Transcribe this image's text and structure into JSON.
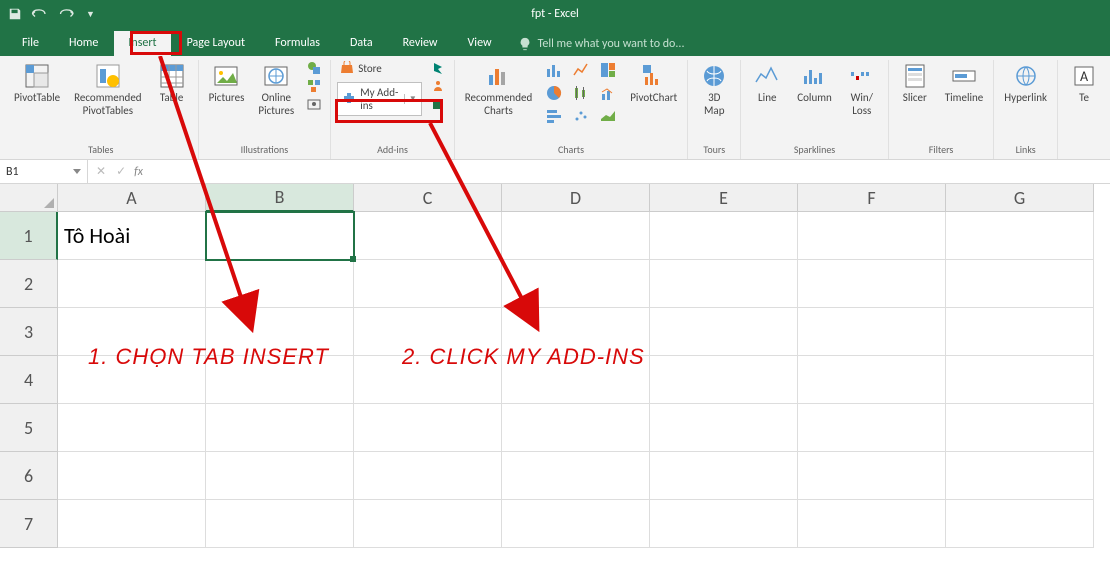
{
  "app": {
    "title": "fpt - Excel"
  },
  "tabs": {
    "file": "File",
    "home": "Home",
    "insert": "Insert",
    "pagelayout": "Page Layout",
    "formulas": "Formulas",
    "data": "Data",
    "review": "Review",
    "view": "View",
    "tellme": "Tell me what you want to do..."
  },
  "ribbon": {
    "tables": {
      "label": "Tables",
      "pivot": "PivotTable",
      "rec": "Recommended\nPivotTables",
      "table": "Table"
    },
    "illus": {
      "label": "Illustrations",
      "pictures": "Pictures",
      "online": "Online\nPictures"
    },
    "addins": {
      "label": "Add-ins",
      "store": "Store",
      "my": "My Add-ins"
    },
    "charts": {
      "label": "Charts",
      "rec": "Recommended\nCharts",
      "pivot": "PivotChart"
    },
    "tours": {
      "label": "Tours",
      "map": "3D\nMap"
    },
    "spark": {
      "label": "Sparklines",
      "line": "Line",
      "col": "Column",
      "wl": "Win/\nLoss"
    },
    "filters": {
      "label": "Filters",
      "slicer": "Slicer",
      "tl": "Timeline"
    },
    "links": {
      "label": "Links",
      "hyper": "Hyperlink"
    },
    "text": "Te"
  },
  "formula": {
    "namebox": "B1"
  },
  "grid": {
    "cols": [
      "A",
      "B",
      "C",
      "D",
      "E",
      "F",
      "G"
    ],
    "rows": [
      "1",
      "2",
      "3",
      "4",
      "5",
      "6",
      "7"
    ],
    "a1": "Tô Hoài",
    "selected_col": 1,
    "selected_row": 0
  },
  "annotations": {
    "t1": "1. Chọn tab Insert",
    "t2": "2. Click My Add-ins"
  }
}
